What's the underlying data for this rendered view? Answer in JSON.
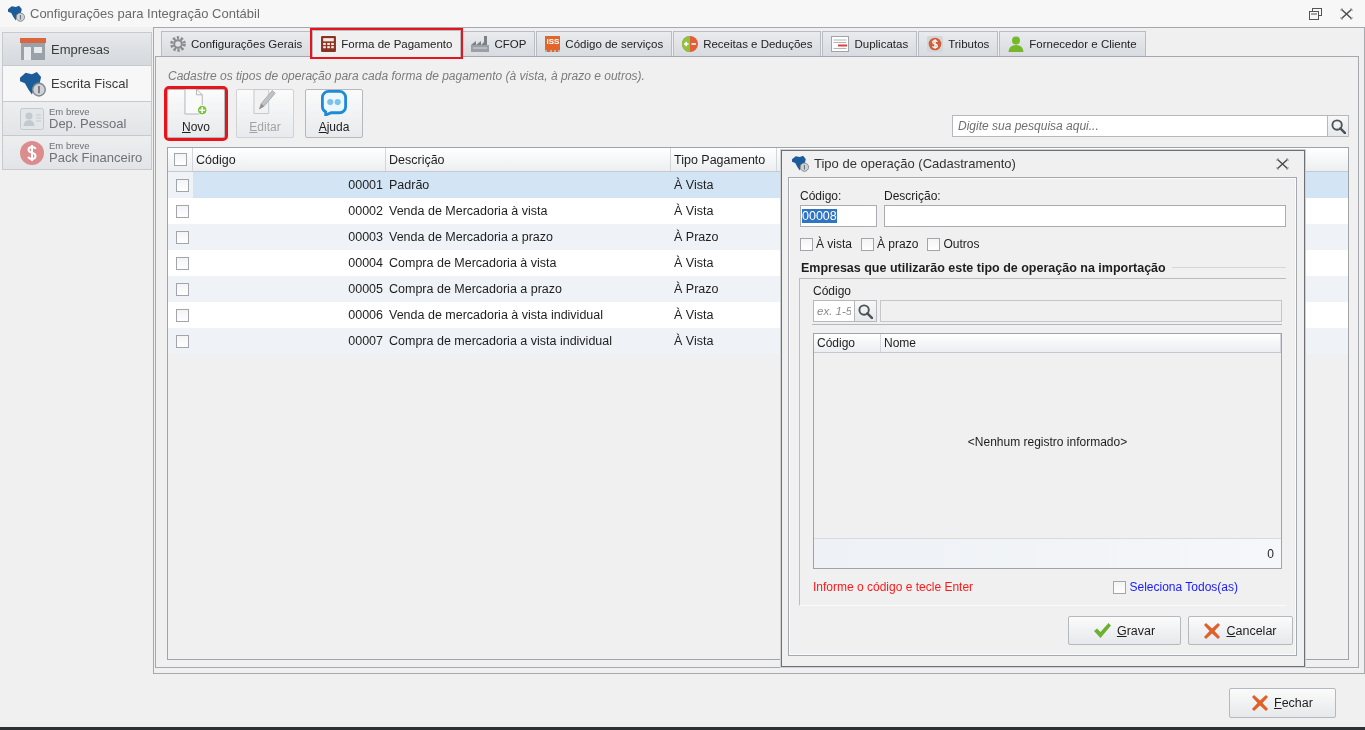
{
  "window": {
    "title": "Configurações para Integração Contábil"
  },
  "sidebar": {
    "items": [
      {
        "label": "Empresas",
        "selected": false,
        "disabled": false
      },
      {
        "label": "Escrita Fiscal",
        "selected": true,
        "disabled": false
      },
      {
        "note": "Em breve",
        "label": "Dep. Pessoal",
        "selected": false,
        "disabled": true
      },
      {
        "note": "Em breve",
        "label": "Pack Financeiro",
        "selected": false,
        "disabled": true
      }
    ]
  },
  "tabs": [
    {
      "label": "Configurações Gerais",
      "selected": false,
      "highlighted": false
    },
    {
      "label": "Forma de Pagamento",
      "selected": true,
      "highlighted": true
    },
    {
      "label": "CFOP",
      "selected": false,
      "highlighted": false
    },
    {
      "badge": "ISS",
      "label": "Código de serviços",
      "selected": false,
      "highlighted": false
    },
    {
      "label": "Receitas e Deduções",
      "selected": false,
      "highlighted": false
    },
    {
      "label": "Duplicatas",
      "selected": false,
      "highlighted": false
    },
    {
      "label": "Tributos",
      "selected": false,
      "highlighted": false
    },
    {
      "label": "Fornecedor e Cliente",
      "selected": false,
      "highlighted": false
    }
  ],
  "page": {
    "description": "Cadastre os tipos de operação para cada forma de pagamento (à vista, à prazo e outros).",
    "toolbar": [
      {
        "label": "Novo",
        "disabled": false,
        "highlighted": true
      },
      {
        "label": "Editar",
        "disabled": true,
        "highlighted": false
      },
      {
        "label": "Ajuda",
        "disabled": false,
        "highlighted": false
      }
    ],
    "search": {
      "placeholder": "Digite sua pesquisa aqui..."
    }
  },
  "table": {
    "all_checked": false,
    "columns": [
      "Código",
      "Descrição",
      "Tipo Pagamento"
    ],
    "rows": [
      {
        "checked": false,
        "selected": true,
        "code": "00001",
        "description": "Padrão",
        "payment_type": "À Vista"
      },
      {
        "checked": false,
        "selected": false,
        "code": "00002",
        "description": "Venda de Mercadoria à vista",
        "payment_type": "À Vista"
      },
      {
        "checked": false,
        "selected": false,
        "code": "00003",
        "description": "Venda de Mercadoria a prazo",
        "payment_type": "À Prazo"
      },
      {
        "checked": false,
        "selected": false,
        "code": "00004",
        "description": "Compra de Mercadoria à vista",
        "payment_type": "À Vista"
      },
      {
        "checked": false,
        "selected": false,
        "code": "00005",
        "description": "Compra de Mercadoria a prazo",
        "payment_type": "À Prazo"
      },
      {
        "checked": false,
        "selected": false,
        "code": "00006",
        "description": "Venda de mercadoria à vista individual",
        "payment_type": "À Vista"
      },
      {
        "checked": false,
        "selected": false,
        "code": "00007",
        "description": "Compra de mercadoria a vista individual",
        "payment_type": "À Vista"
      }
    ]
  },
  "dialog": {
    "title": "Tipo de operação (Cadastramento)",
    "code": {
      "label": "Código:",
      "value": "00008",
      "value_selected": true
    },
    "description": {
      "label": "Descrição:"
    },
    "payment_options": [
      {
        "label": "À vista",
        "checked": false
      },
      {
        "label": "À prazo",
        "checked": false
      },
      {
        "label": "Outros",
        "checked": false
      }
    ],
    "section_title": "Empresas que utilizarão este tipo de operação na importação",
    "company_lookup": {
      "label": "Código",
      "placeholder": "ex. 1-5"
    },
    "grid": {
      "columns": [
        "Código",
        "Nome"
      ],
      "empty_message": "<Nenhum registro informado>",
      "count": "0"
    },
    "hint": "Informe o código e tecle Enter",
    "select_all": {
      "label": "Seleciona Todos(as)",
      "checked": false
    },
    "buttons": [
      {
        "label": "Gravar",
        "kind": "confirm"
      },
      {
        "label": "Cancelar",
        "kind": "cancel"
      }
    ]
  },
  "footer": {
    "buttons": [
      {
        "label": "Fechar",
        "kind": "close"
      }
    ]
  }
}
